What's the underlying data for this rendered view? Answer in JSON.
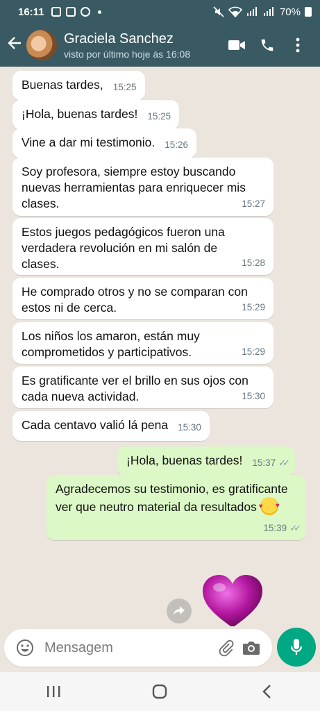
{
  "status_bar": {
    "time": "16:11",
    "battery": "70%"
  },
  "contact": {
    "name": "Graciela Sanchez",
    "last_seen": "visto por último hoje às 16:08"
  },
  "messages": [
    {
      "text": "Buenas tardes,",
      "time": "15:25"
    },
    {
      "text": "¡Hola, buenas tardes!",
      "time": "15:25"
    },
    {
      "text": "Vine a dar mi testimonio.",
      "time": "15:26"
    },
    {
      "text": "Soy profesora, siempre estoy buscando nuevas herramientas para enriquecer mis clases.",
      "time": "15:27"
    },
    {
      "text": "Estos juegos pedagógicos fueron una verdadera revolución en mi salón de clases.",
      "time": "15:28"
    },
    {
      "text": "He comprado otros y no se comparan con estos ni de cerca.",
      "time": "15:29"
    },
    {
      "text": "Los niños los amaron, están muy comprometidos y participativos.",
      "time": "15:29"
    },
    {
      "text": "Es gratificante ver el brillo en sus ojos con cada nueva actividad.",
      "time": "15:30"
    },
    {
      "text": "Cada centavo valió lá pena",
      "time": "15:30"
    },
    {
      "text": "¡Hola, buenas tardes!",
      "time": "15:37"
    },
    {
      "text": "Agradecemos su testimonio, es gratificante ver que neutro material da resultados",
      "time": "15:39"
    }
  ],
  "input": {
    "placeholder": "Mensagem"
  },
  "colors": {
    "header": "#3a5a63",
    "outgoing": "#dcf8c6",
    "incoming": "#ffffff",
    "mic": "#00a884",
    "chat_bg": "#ece5dd"
  },
  "icons": [
    "back-arrow-icon",
    "video-call-icon",
    "phone-icon",
    "more-vert-icon",
    "emoji-icon",
    "attach-icon",
    "camera-icon",
    "mic-icon",
    "forward-icon",
    "heart-sticker",
    "recents-icon",
    "home-icon",
    "back-nav-icon"
  ]
}
